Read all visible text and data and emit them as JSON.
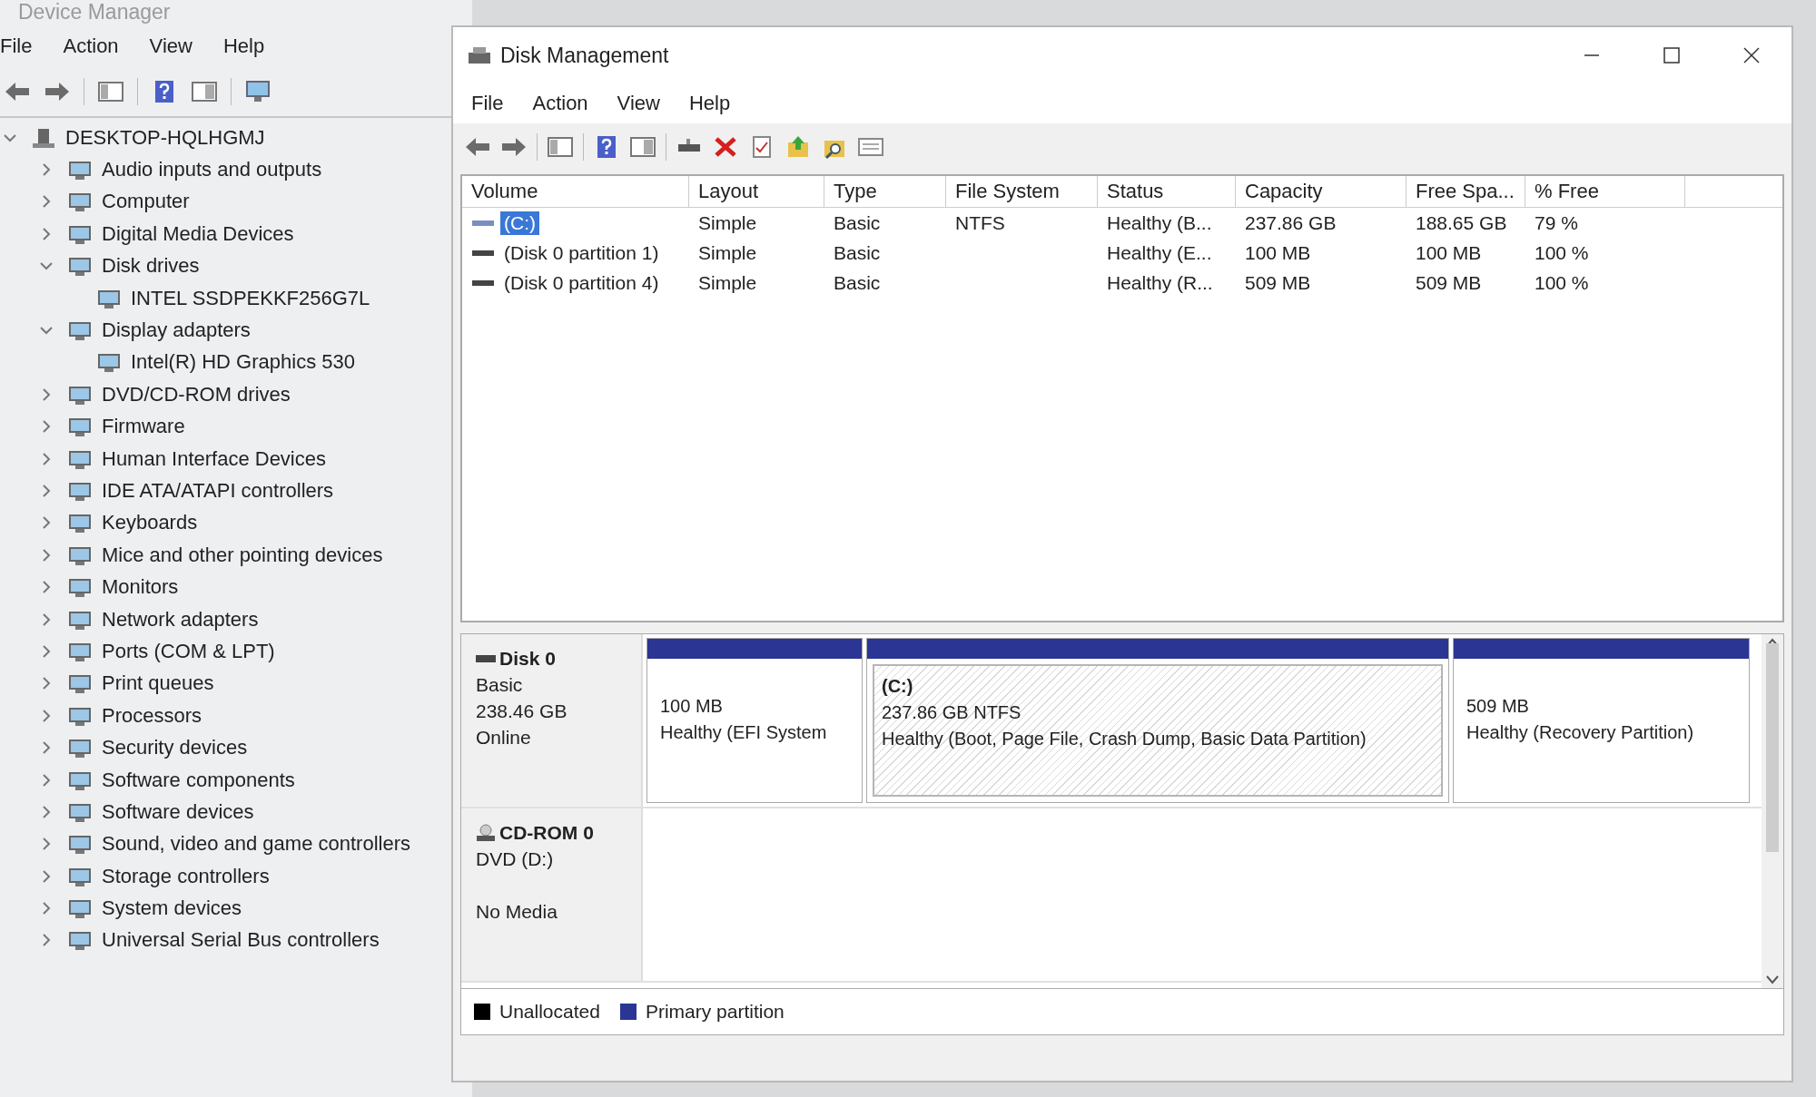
{
  "device_manager": {
    "title": "Device Manager",
    "menu": [
      "File",
      "Action",
      "View",
      "Help"
    ],
    "tree": {
      "label": "DESKTOP-HQLHGMJ",
      "expanded": true,
      "children": [
        {
          "label": "Audio inputs and outputs",
          "expanded": false
        },
        {
          "label": "Computer",
          "expanded": false
        },
        {
          "label": "Digital Media Devices",
          "expanded": false
        },
        {
          "label": "Disk drives",
          "expanded": true,
          "children": [
            {
              "label": "INTEL SSDPEKKF256G7L"
            }
          ]
        },
        {
          "label": "Display adapters",
          "expanded": true,
          "children": [
            {
              "label": "Intel(R) HD Graphics 530"
            }
          ]
        },
        {
          "label": "DVD/CD-ROM drives",
          "expanded": false
        },
        {
          "label": "Firmware",
          "expanded": false
        },
        {
          "label": "Human Interface Devices",
          "expanded": false
        },
        {
          "label": "IDE ATA/ATAPI controllers",
          "expanded": false
        },
        {
          "label": "Keyboards",
          "expanded": false
        },
        {
          "label": "Mice and other pointing devices",
          "expanded": false
        },
        {
          "label": "Monitors",
          "expanded": false
        },
        {
          "label": "Network adapters",
          "expanded": false
        },
        {
          "label": "Ports (COM & LPT)",
          "expanded": false
        },
        {
          "label": "Print queues",
          "expanded": false
        },
        {
          "label": "Processors",
          "expanded": false
        },
        {
          "label": "Security devices",
          "expanded": false
        },
        {
          "label": "Software components",
          "expanded": false
        },
        {
          "label": "Software devices",
          "expanded": false
        },
        {
          "label": "Sound, video and game controllers",
          "expanded": false
        },
        {
          "label": "Storage controllers",
          "expanded": false
        },
        {
          "label": "System devices",
          "expanded": false
        },
        {
          "label": "Universal Serial Bus controllers",
          "expanded": false
        }
      ]
    }
  },
  "disk_management": {
    "title": "Disk Management",
    "menu": [
      "File",
      "Action",
      "View",
      "Help"
    ],
    "table": {
      "columns": [
        "Volume",
        "Layout",
        "Type",
        "File System",
        "Status",
        "Capacity",
        "Free Spa...",
        "% Free"
      ],
      "rows": [
        {
          "cells": [
            "(C:)",
            "Simple",
            "Basic",
            "NTFS",
            "Healthy (B...",
            "237.86 GB",
            "188.65 GB",
            "79 %"
          ],
          "selected": true
        },
        {
          "cells": [
            "(Disk 0 partition 1)",
            "Simple",
            "Basic",
            null,
            "Healthy (E...",
            "100 MB",
            "100 MB",
            "100 %"
          ],
          "selected": false
        },
        {
          "cells": [
            "(Disk 0 partition 4)",
            "Simple",
            "Basic",
            null,
            "Healthy (R...",
            "509 MB",
            "509 MB",
            "100 %"
          ],
          "selected": false
        }
      ]
    },
    "disks": [
      {
        "kind": "disk",
        "name": "Disk 0",
        "lines": [
          "Basic",
          "238.46 GB",
          "Online"
        ],
        "partitions": [
          {
            "lines": [
              "100 MB",
              "Healthy (EFI System"
            ],
            "selected": false
          },
          {
            "title": "(C:)",
            "lines": [
              "237.86 GB NTFS",
              "Healthy (Boot, Page File, Crash Dump, Basic Data Partition)"
            ],
            "selected": true
          },
          {
            "lines": [
              "509 MB",
              "Healthy (Recovery Partition)"
            ],
            "selected": false
          }
        ]
      },
      {
        "kind": "cdrom",
        "name": "CD-ROM 0",
        "lines": [
          "DVD (D:)",
          "No Media"
        ]
      }
    ],
    "legend": [
      {
        "label": "Unallocated",
        "color": "#000000"
      },
      {
        "label": "Primary partition",
        "color": "#2b3593"
      }
    ]
  }
}
